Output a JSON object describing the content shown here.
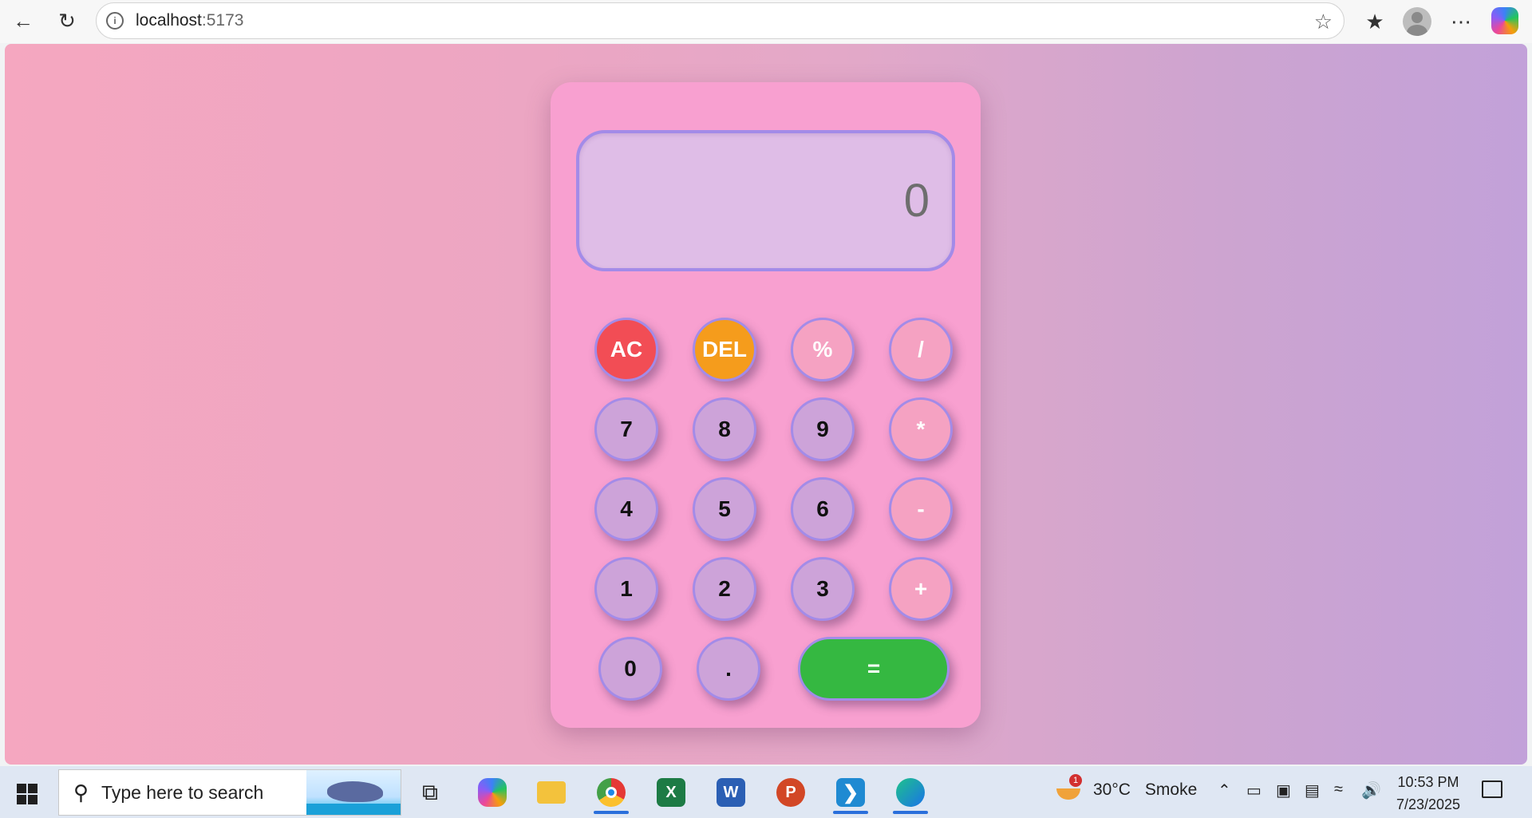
{
  "browser": {
    "url_host": "localhost",
    "url_port": ":5173",
    "back_icon": "arrow-left-icon",
    "reload_icon": "reload-icon",
    "info_icon": "info-icon",
    "favorite_icon": "star-icon",
    "favorites_icon": "favorites-list-icon",
    "more_icon": "more-icon"
  },
  "calculator": {
    "display": "0",
    "keys": {
      "ac": "AC",
      "del": "DEL",
      "percent": "%",
      "divide": "/",
      "seven": "7",
      "eight": "8",
      "nine": "9",
      "multiply": "*",
      "four": "4",
      "five": "5",
      "six": "6",
      "minus": "-",
      "one": "1",
      "two": "2",
      "three": "3",
      "plus": "+",
      "zero": "0",
      "dot": ".",
      "equals": "="
    },
    "colors": {
      "body": "#f8a0d0",
      "display_bg": "#dfbde7",
      "number_key": "#cda3d9",
      "operator_key": "#f5a2c2",
      "ac_key": "#f24d55",
      "del_key": "#f59c1c",
      "equals_key": "#35b841"
    }
  },
  "taskbar": {
    "search_placeholder": "Type here to search",
    "weather_temp": "30°C",
    "weather_desc": "Smoke",
    "weather_badge": "1",
    "time": "10:53 PM",
    "date": "7/23/2025",
    "apps": [
      "Task View",
      "Copilot",
      "File Explorer",
      "Chrome",
      "Excel",
      "Word",
      "PowerPoint",
      "VS Code",
      "Edge"
    ]
  }
}
